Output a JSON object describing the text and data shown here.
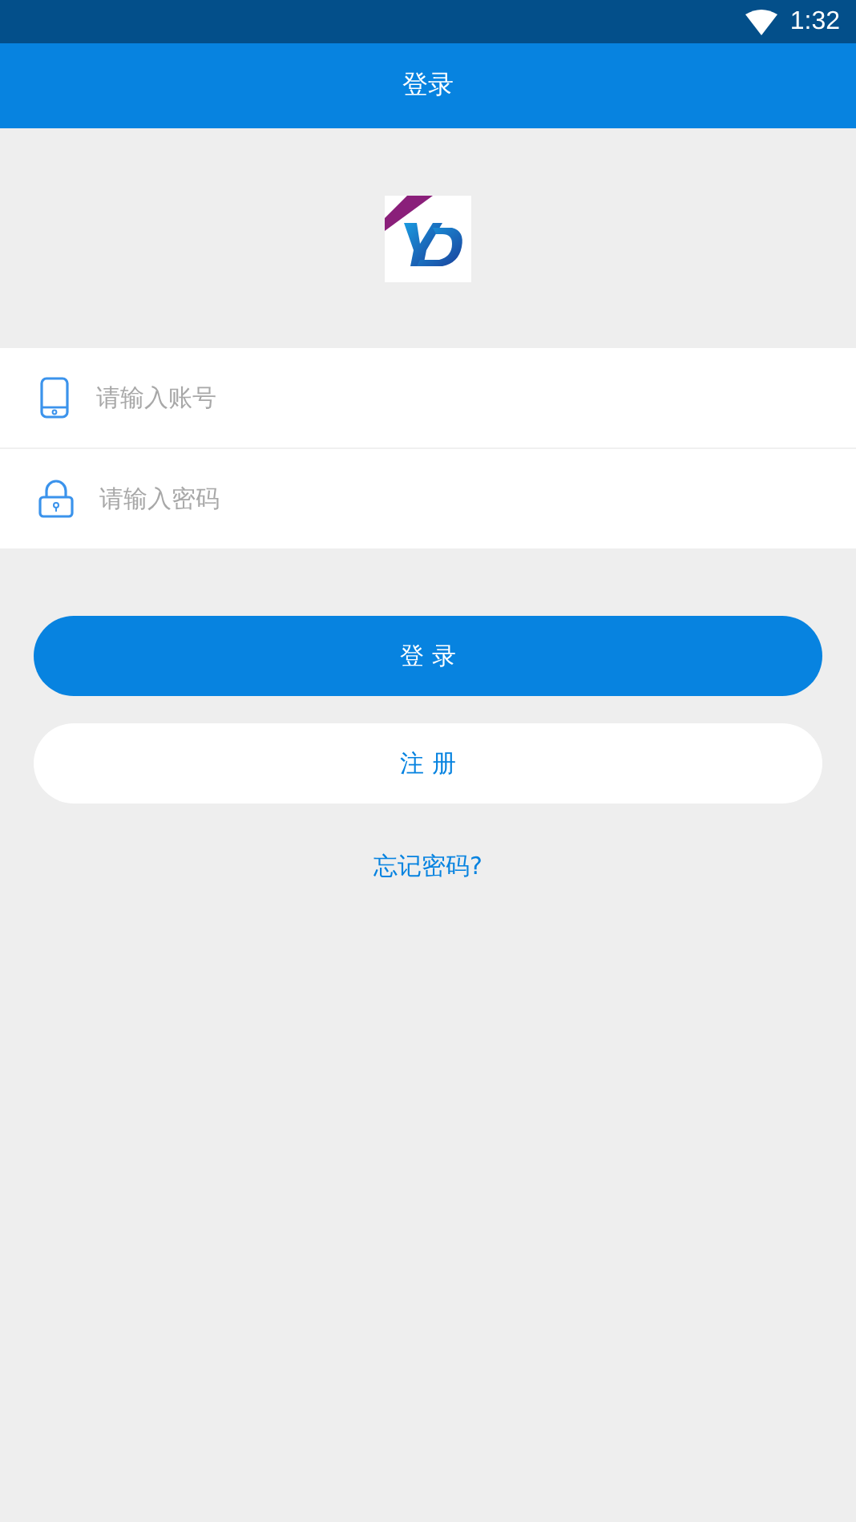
{
  "status_bar": {
    "time": "1:32"
  },
  "header": {
    "title": "登录"
  },
  "form": {
    "fields": [
      {
        "kind": "account",
        "placeholder": "请输入账号"
      },
      {
        "kind": "password",
        "placeholder": "请输入密码"
      }
    ]
  },
  "buttons": [
    {
      "kind": "primary",
      "label": "登 录"
    },
    {
      "kind": "secondary",
      "label": "注 册"
    }
  ],
  "forgot_link": "忘记密码?"
}
